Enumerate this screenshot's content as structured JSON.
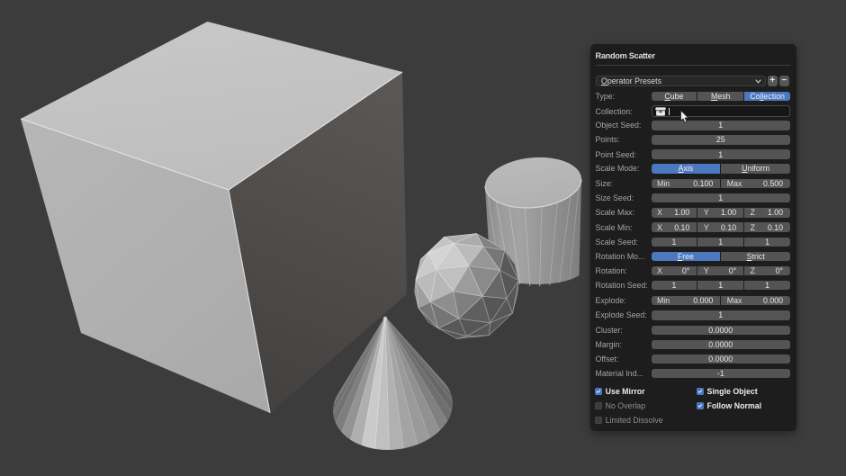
{
  "viewport": {
    "background_color": "#3c3c3c",
    "objects": [
      {
        "name": "cube"
      },
      {
        "name": "cylinder"
      },
      {
        "name": "icosphere"
      },
      {
        "name": "cone"
      }
    ]
  },
  "panel": {
    "title": "Random Scatter",
    "presets": {
      "b": "",
      "u": "O",
      "a": "perator Presets",
      "plus": "+",
      "minus": "−"
    },
    "rows": [
      {
        "label": "Type:",
        "type": "seg",
        "name": "type",
        "opts": [
          {
            "b": "",
            "u": "C",
            "a": "ube",
            "selected": false
          },
          {
            "b": "",
            "u": "M",
            "a": "esh",
            "selected": false
          },
          {
            "b": "Co",
            "u": "ll",
            "a": "ection",
            "selected": true
          }
        ]
      },
      {
        "label": "Collection:",
        "type": "collection",
        "name": "collection"
      },
      {
        "label": "Object Seed:",
        "type": "single",
        "name": "object-seed",
        "value": "1"
      },
      {
        "label": "Points:",
        "type": "single",
        "name": "points",
        "value": "25"
      },
      {
        "label": "Point Seed:",
        "type": "single",
        "name": "point-seed",
        "value": "1"
      },
      {
        "label": "Scale Mode:",
        "type": "seg",
        "name": "scale-mode",
        "opts": [
          {
            "b": "",
            "u": "A",
            "a": "xis",
            "selected": true
          },
          {
            "b": "",
            "u": "U",
            "a": "niform",
            "selected": false
          }
        ]
      },
      {
        "label": "Size:",
        "type": "pair",
        "name": "size",
        "fields": [
          {
            "k": "Min",
            "v": "0.100"
          },
          {
            "k": "Max",
            "v": "0.500"
          }
        ]
      },
      {
        "label": "Size Seed:",
        "type": "single",
        "name": "size-seed",
        "value": "1"
      },
      {
        "label": "Scale Max:",
        "type": "pair",
        "name": "scale-max",
        "fields": [
          {
            "k": "X",
            "v": "1.00"
          },
          {
            "k": "Y",
            "v": "1.00"
          },
          {
            "k": "Z",
            "v": "1.00"
          }
        ]
      },
      {
        "label": "Scale Min:",
        "type": "pair",
        "name": "scale-min",
        "fields": [
          {
            "k": "X",
            "v": "0.10"
          },
          {
            "k": "Y",
            "v": "0.10"
          },
          {
            "k": "Z",
            "v": "0.10"
          }
        ]
      },
      {
        "label": "Scale Seed:",
        "type": "triple",
        "name": "scale-seed",
        "values": [
          "1",
          "1",
          "1"
        ]
      },
      {
        "label": "Rotation Mo...",
        "type": "seg",
        "name": "rotation-mode",
        "opts": [
          {
            "b": "",
            "u": "F",
            "a": "ree",
            "selected": true
          },
          {
            "b": "",
            "u": "S",
            "a": "trict",
            "selected": false
          }
        ]
      },
      {
        "label": "Rotation:",
        "type": "pair",
        "name": "rotation",
        "fields": [
          {
            "k": "X",
            "v": "0°"
          },
          {
            "k": "Y",
            "v": "0°"
          },
          {
            "k": "Z",
            "v": "0°"
          }
        ]
      },
      {
        "label": "Rotation Seed:",
        "type": "triple",
        "name": "rotation-seed",
        "values": [
          "1",
          "1",
          "1"
        ]
      },
      {
        "label": "Explode:",
        "type": "pair",
        "name": "explode",
        "fields": [
          {
            "k": "Min",
            "v": "0.000"
          },
          {
            "k": "Max",
            "v": "0.000"
          }
        ]
      },
      {
        "label": "Explode Seed:",
        "type": "single",
        "name": "explode-seed",
        "value": "1"
      },
      {
        "label": "Cluster:",
        "type": "single",
        "name": "cluster",
        "value": "0.0000"
      },
      {
        "label": "Margin:",
        "type": "single",
        "name": "margin",
        "value": "0.0000"
      },
      {
        "label": "Offset:",
        "type": "single",
        "name": "offset",
        "value": "0.0000"
      },
      {
        "label": "Material Ind...",
        "type": "single",
        "name": "material-index",
        "value": "-1"
      }
    ],
    "checkboxes": [
      {
        "label": "Use Mirror",
        "checked": true,
        "col": 0,
        "row": 0,
        "name": "use-mirror"
      },
      {
        "label": "Single Object",
        "checked": true,
        "col": 1,
        "row": 0,
        "name": "single-object"
      },
      {
        "label": "No Overlap",
        "checked": false,
        "col": 0,
        "row": 1,
        "name": "no-overlap"
      },
      {
        "label": "Follow Normal",
        "checked": true,
        "col": 1,
        "row": 1,
        "name": "follow-normal"
      },
      {
        "label": "Limited Dissolve",
        "checked": false,
        "col": 0,
        "row": 2,
        "name": "limited-dissolve"
      }
    ],
    "colors": {
      "accent_blue": "#4b78bf",
      "panel_background": "#1d1d1d",
      "field_background": "#545454",
      "label_text": "#a5a5a5",
      "value_text": "#e6e6e6"
    }
  }
}
